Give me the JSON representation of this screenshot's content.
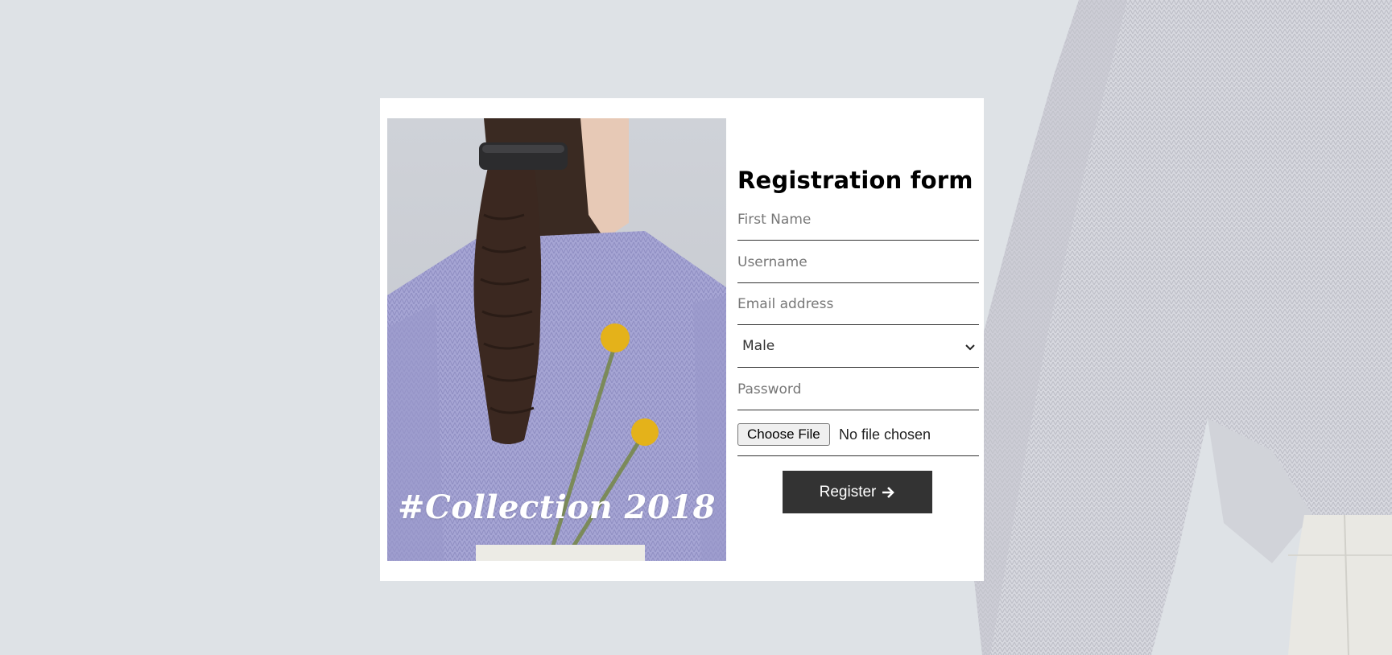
{
  "hero": {
    "caption": "#Collection 2018"
  },
  "form": {
    "title": "Registration form",
    "fields": {
      "first_name_placeholder": "First Name",
      "username_placeholder": "Username",
      "email_placeholder": "Email address",
      "gender_value": "Male",
      "password_placeholder": "Password"
    },
    "file": {
      "button_label": "Choose File",
      "status": "No file chosen"
    },
    "submit": {
      "label": "Register",
      "icon": "arrow-right-icon"
    }
  },
  "colors": {
    "background": "#dee2e6",
    "card": "#ffffff",
    "button": "#333333",
    "sweater_lavender": "#a9a8d6",
    "flower_yellow": "#e4b21a"
  }
}
